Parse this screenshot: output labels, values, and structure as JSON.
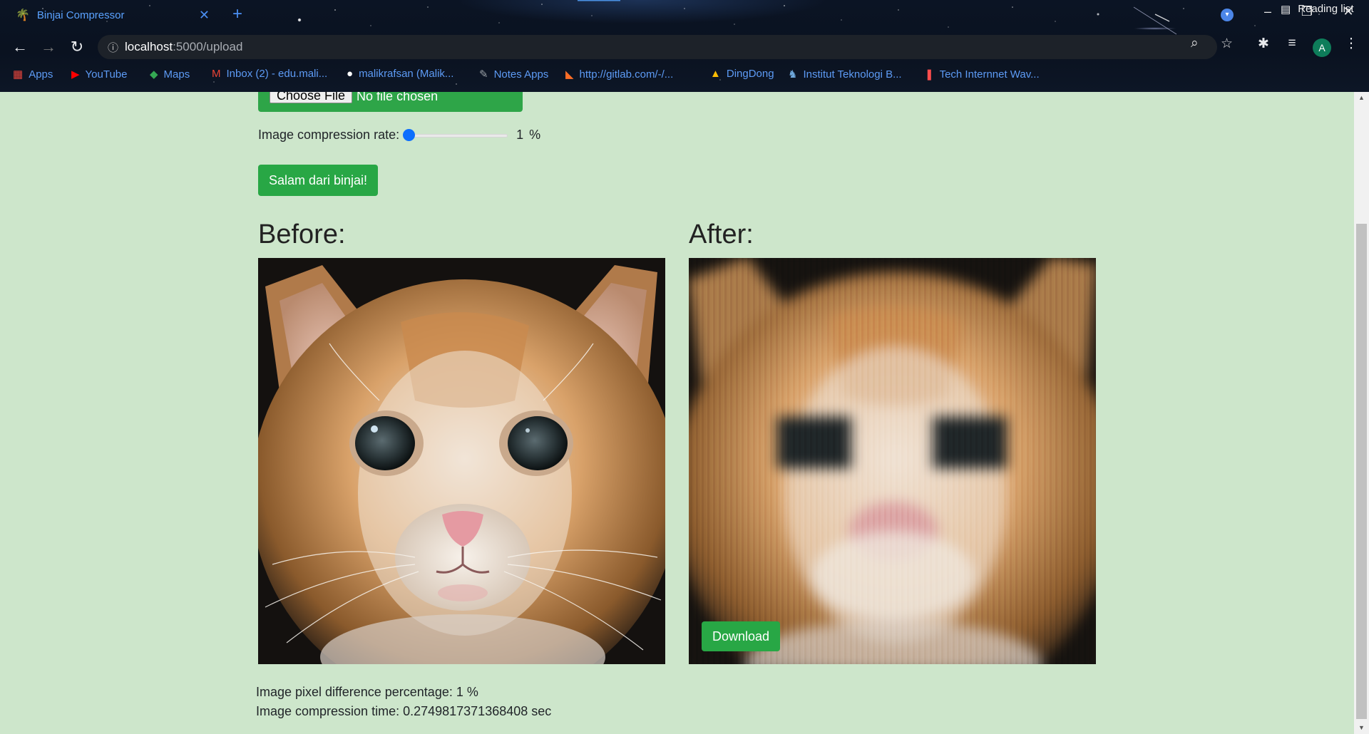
{
  "browser": {
    "tab_title": "Binjai Compressor",
    "tab_close": "✕",
    "new_tab": "+",
    "url_host": "localhost",
    "url_path": ":5000/upload",
    "avatar_letter": "A",
    "reading_list": "Reading list",
    "bookmarks": [
      {
        "label": "Apps",
        "icon": "apps-grid-icon",
        "glyph": "▦",
        "color": "#e8453c"
      },
      {
        "label": "YouTube",
        "icon": "youtube-icon",
        "glyph": "▶",
        "color": "#ff0000"
      },
      {
        "label": "Maps",
        "icon": "maps-pin-icon",
        "glyph": "◆",
        "color": "#34a853"
      },
      {
        "label": "Inbox (2) - edu.mali...",
        "icon": "gmail-icon",
        "glyph": "M",
        "color": "#ea4335"
      },
      {
        "label": "malikrafsan (Malik...",
        "icon": "github-icon",
        "glyph": "●",
        "color": "#ffffff"
      },
      {
        "label": "Notes Apps",
        "icon": "notes-icon",
        "glyph": "✎",
        "color": "#9aa0a6"
      },
      {
        "label": "http://gitlab.com/-/...",
        "icon": "gitlab-icon",
        "glyph": "◣",
        "color": "#fc6d26"
      },
      {
        "label": "DingDong",
        "icon": "google-drive-icon",
        "glyph": "▲",
        "color": "#fbbc04"
      },
      {
        "label": "Institut Teknologi B...",
        "icon": "itb-icon",
        "glyph": "♞",
        "color": "#6fa8dc"
      },
      {
        "label": "Tech Internnet Wav...",
        "icon": "tech-bookmark-icon",
        "glyph": "❚",
        "color": "#ff4d4d"
      }
    ]
  },
  "form": {
    "choose_file": "Choose File",
    "no_file": "No file chosen",
    "rate_label": "Image compression rate:",
    "rate_value": "1",
    "rate_unit": "%",
    "rate_fraction": 0.01,
    "submit_label": "Salam dari binjai!"
  },
  "results": {
    "before_title": "Before:",
    "after_title": "After:",
    "download_label": "Download",
    "pixel_diff": "Image pixel difference percentage: 1 %",
    "compression_time": "Image compression time: 0.2749817371368408 sec"
  }
}
